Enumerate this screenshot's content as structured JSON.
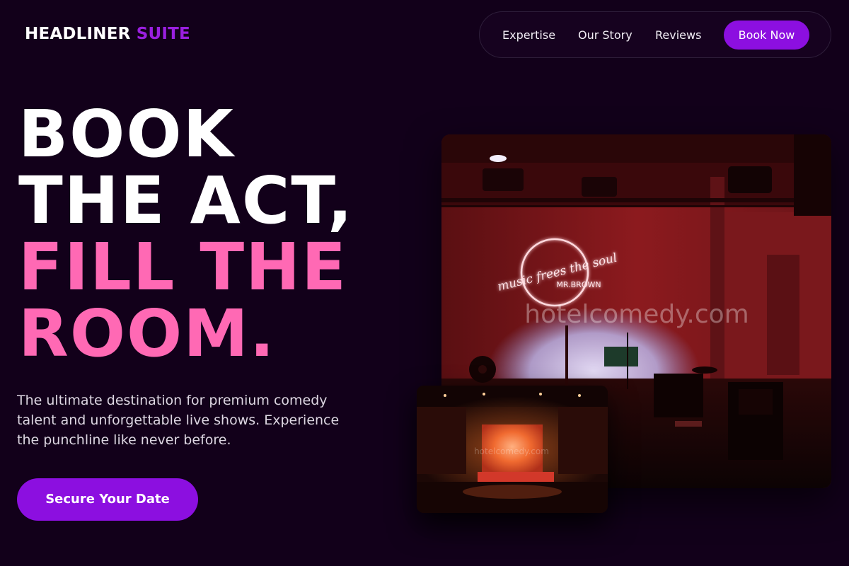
{
  "brand": {
    "name_primary": "HEADLINER",
    "name_accent": "SUITE"
  },
  "nav": {
    "items": [
      "Expertise",
      "Our Story",
      "Reviews"
    ],
    "book_label": "Book Now"
  },
  "hero": {
    "headline_lines": [
      "BOOK",
      "THE ACT,",
      "FILL THE",
      "ROOM."
    ],
    "subtitle": "The ultimate destination for premium comedy talent and unforgettable live shows. Experience the punchline like never before.",
    "cta_label": "Secure Your Date"
  },
  "images": {
    "main": {
      "neon_line1": "music frees the soul",
      "neon_line2": "MR.BROWN",
      "watermark": "hotelcomedy.com"
    },
    "small": {
      "watermark": "hotelcomedy.com"
    }
  },
  "colors": {
    "background": "#12001a",
    "accent_purple": "#8c0fe0",
    "headline_pink": "#ff69b4"
  }
}
